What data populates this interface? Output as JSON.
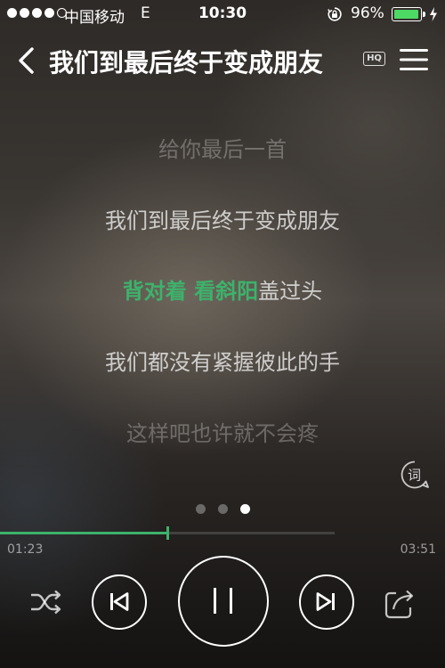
{
  "status_bar": {
    "carrier": "中国移动",
    "network": "E",
    "time": "10:30",
    "battery_percent": "96%",
    "battery_level": 0.96,
    "signal_bars_filled": 4,
    "signal_bars_total": 5
  },
  "header": {
    "title": "我们到最后终于变成朋友",
    "quality_badge": "HQ"
  },
  "lyrics": {
    "lines": [
      {
        "text": "给你最后一首",
        "state": "past"
      },
      {
        "text": "我们到最后终于变成朋友",
        "state": "near"
      },
      {
        "sung": "背对着 看斜阳",
        "unsung": "盖过头",
        "state": "current"
      },
      {
        "text": "我们都没有紧握彼此的手",
        "state": "near"
      },
      {
        "text": "这样吧也许就不会疼",
        "state": "upcoming"
      }
    ]
  },
  "lyric_toggle_label": "词",
  "pager": {
    "count": 3,
    "active_index": 2
  },
  "player": {
    "elapsed": "01:23",
    "total": "03:51",
    "progress_fraction": 0.5,
    "accent_color": "#3db26b",
    "state": "playing"
  },
  "icons": {
    "back": "chevron-left-icon",
    "menu": "hamburger-menu-icon",
    "shuffle": "shuffle-icon",
    "prev": "skip-previous-icon",
    "pause": "pause-icon",
    "next": "skip-next-icon",
    "share": "share-icon",
    "lyric_toggle": "lyrics-icon"
  }
}
